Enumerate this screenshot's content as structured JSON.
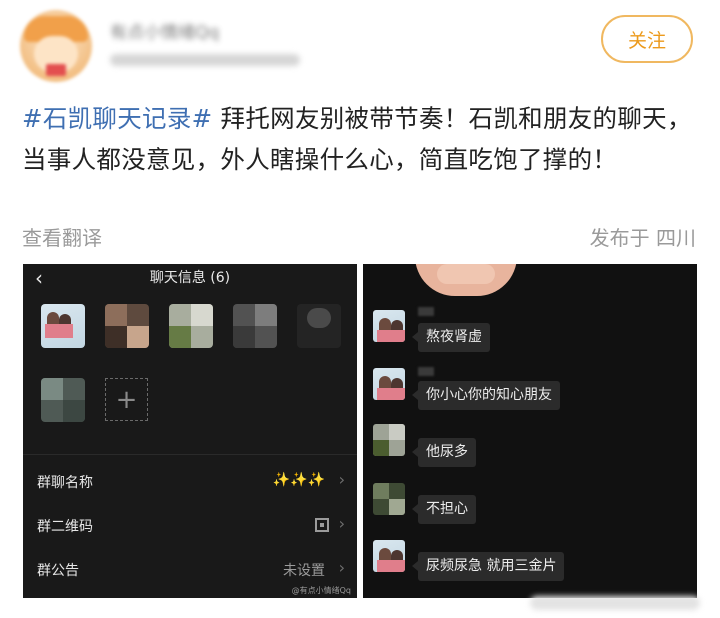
{
  "header": {
    "username": "有点小情绪Qq",
    "follow_label": "关注"
  },
  "post": {
    "hashtag": "#石凯聊天记录#",
    "body": " 拜托网友别被带节奏！石凯和朋友的聊天，当事人都没意见，外人瞎操什么心，简直吃饱了撑的！",
    "translate_label": "查看翻译",
    "location_label": "发布于 四川"
  },
  "left_screenshot": {
    "back_icon": "‹",
    "title": "聊天信息 (6)",
    "add_member_icon": "+",
    "rows": [
      {
        "label": "群聊名称",
        "value": "✨✨✨"
      },
      {
        "label": "群二维码",
        "value": ""
      },
      {
        "label": "群公告",
        "value": "未设置"
      }
    ],
    "watermark": "@有点小情绪Qq"
  },
  "right_screenshot": {
    "messages": [
      {
        "text": "熬夜肾虚"
      },
      {
        "text": "你小心你的知心朋友"
      },
      {
        "text": "他尿多"
      },
      {
        "text": "不担心"
      },
      {
        "text": "尿频尿急 就用三金片"
      }
    ]
  },
  "colors": {
    "hashtag": "#3f6fb2",
    "follow_text": "#ec9a1c",
    "follow_border": "#f0b860",
    "text_secondary": "#9a9a9a"
  }
}
